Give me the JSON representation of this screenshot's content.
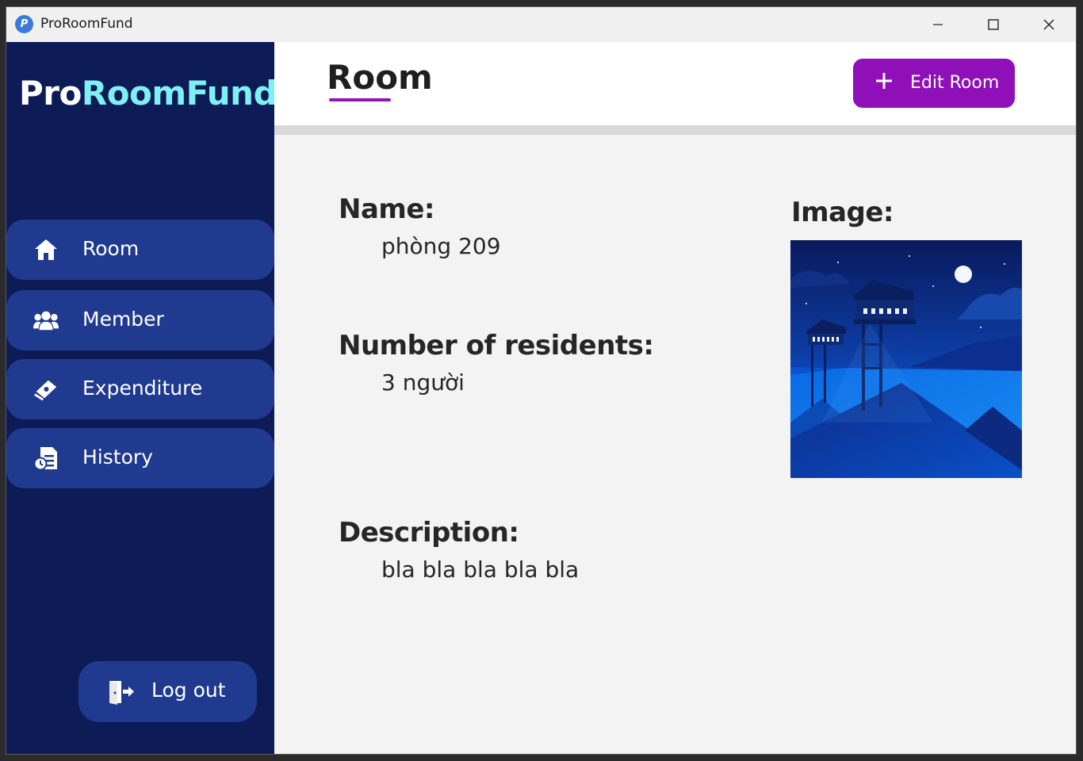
{
  "window": {
    "title": "ProRoomFund"
  },
  "brand": {
    "part1": "Pro",
    "part2": "RoomFund"
  },
  "sidebar": {
    "items": [
      {
        "label": "Room",
        "icon": "home-icon"
      },
      {
        "label": "Member",
        "icon": "users-icon"
      },
      {
        "label": "Expenditure",
        "icon": "money-icon"
      },
      {
        "label": "History",
        "icon": "history-icon"
      }
    ],
    "logout": {
      "label": "Log out",
      "icon": "logout-icon"
    }
  },
  "header": {
    "title": "Room",
    "edit_button": "Edit Room"
  },
  "room": {
    "name_label": "Name:",
    "name_value": "phòng 209",
    "residents_label": "Number of residents:",
    "residents_value": "3 người",
    "description_label": "Description:",
    "description_value": "bla bla bla bla bla",
    "image_label": "Image:"
  },
  "colors": {
    "sidebar_bg": "#0d1b57",
    "nav_item_bg": "#1f3a8f",
    "accent_purple": "#8f0fb9",
    "brand_cyan": "#7ef0f2"
  }
}
